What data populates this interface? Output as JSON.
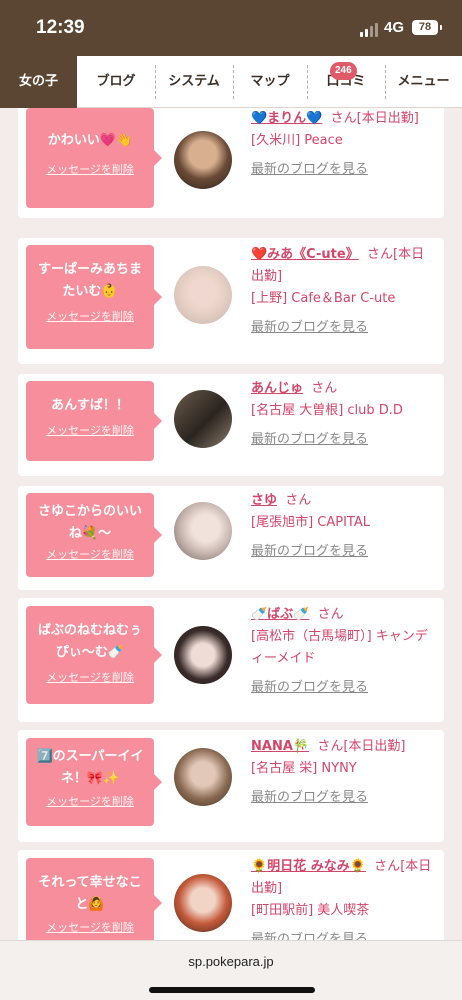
{
  "status_bar": {
    "time": "12:39",
    "network": "4G",
    "battery": "78"
  },
  "nav": {
    "tabs": [
      {
        "label": "女の子",
        "active": true
      },
      {
        "label": "ブログ"
      },
      {
        "label": "システム"
      },
      {
        "label": "マップ"
      },
      {
        "label": "口コミ",
        "badge": "246"
      },
      {
        "label": "メニュー"
      }
    ]
  },
  "colors": {
    "brand_brown": "#5b4634",
    "bubble_pink": "#f78e9b",
    "name_pink": "#d4456a"
  },
  "cards": [
    {
      "message": "かわいい💗👋",
      "delete_label": "メッセージを削除",
      "name": "💙まりん💙",
      "san": "さん",
      "status": "[本日出勤]",
      "shop": "[久米川] Peace",
      "blog": "最新のブログを見る"
    },
    {
      "message": "すーぱーみあちまたいむ👶",
      "delete_label": "メッセージを削除",
      "name": "❤️みあ《C-ute》",
      "san": "さん",
      "status": "[本日出勤]",
      "shop": "[上野] Cafe＆Bar C-ute",
      "blog": "最新のブログを見る"
    },
    {
      "message": "あんすば！！",
      "delete_label": "メッセージを削除",
      "name": "あんじゅ",
      "san": "さん",
      "status": "",
      "shop": "[名古屋 大曽根] club D.D",
      "blog": "最新のブログを見る"
    },
    {
      "message": "さゆこからのいいね💐〜",
      "delete_label": "メッセージを削除",
      "name": "さゆ",
      "san": "さん",
      "status": "",
      "shop": "[尾張旭市] CAPITAL",
      "blog": "最新のブログを見る"
    },
    {
      "message": "ばぶのねむねむぅぴぃ〜む🍼",
      "delete_label": "メッセージを削除",
      "name": "🍼ばぶ🍼",
      "san": "さん",
      "status": "",
      "shop": "[高松市（古馬場町）] キャンディーメイド",
      "blog": "最新のブログを見る"
    },
    {
      "message": "7️⃣のスーパーイイネ！🎀✨",
      "delete_label": "メッセージを削除",
      "name": "NANA🎋",
      "san": "さん",
      "status": "[本日出勤]",
      "shop": "[名古屋 栄] NYNY",
      "blog": "最新のブログを見る"
    },
    {
      "message": "それって幸せなこと🙆",
      "delete_label": "メッセージを削除",
      "name": "🌻明日花 みなみ🌻",
      "san": "さん",
      "status": "[本日出勤]",
      "shop": "[町田駅前] 美人喫茶",
      "blog": "最新のブログを見る"
    }
  ],
  "url_bar": {
    "url": "sp.pokepara.jp"
  }
}
